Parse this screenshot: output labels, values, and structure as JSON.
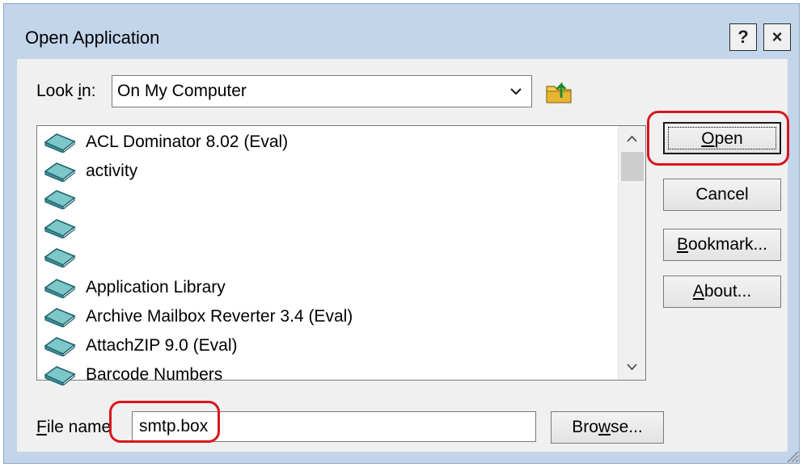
{
  "window": {
    "title": "Open Application",
    "help_label": "?",
    "close_label": "×"
  },
  "look_in": {
    "label_pre": "Look ",
    "label_key": "i",
    "label_post": "n:",
    "value": "On My Computer"
  },
  "apps": [
    {
      "name": "ACL Dominator 8.02 (Eval)"
    },
    {
      "name": "activity"
    },
    {
      "name": ""
    },
    {
      "name": ""
    },
    {
      "name": ""
    },
    {
      "name": "Application Library"
    },
    {
      "name": "Archive Mailbox Reverter 3.4 (Eval)"
    },
    {
      "name": "AttachZIP 9.0 (Eval)"
    },
    {
      "name": "Barcode Numbers"
    }
  ],
  "buttons": {
    "open_key": "O",
    "open_rest": "pen",
    "cancel": "Cancel",
    "bookmark_key": "B",
    "bookmark_rest": "ookmark...",
    "about_key": "A",
    "about_rest": "bout...",
    "browse_pre": "Bro",
    "browse_key": "w",
    "browse_post": "se..."
  },
  "file_name": {
    "label_key": "F",
    "label_rest": "ile name",
    "value": "smtp.box"
  },
  "colors": {
    "highlight": "#d8161e",
    "icon": "#4aa3a3"
  }
}
